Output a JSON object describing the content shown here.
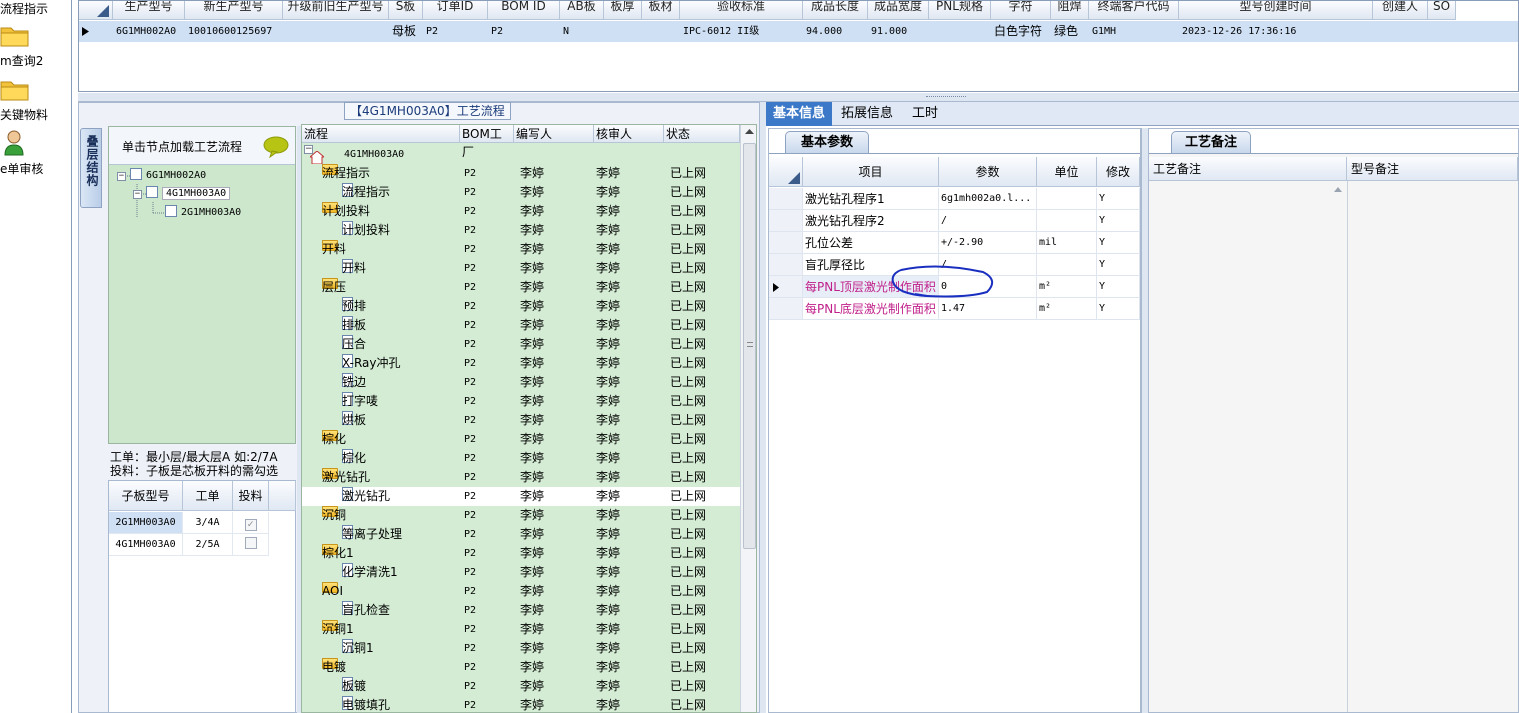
{
  "left_nav": {
    "items": [
      {
        "label": "流程指示",
        "icon": "folder-icon"
      },
      {
        "label": "m查询2",
        "icon": "folder-icon"
      },
      {
        "label": "关键物料",
        "icon": "folder-icon"
      },
      {
        "label": "e单审核",
        "icon": "user-icon"
      }
    ]
  },
  "top_grid": {
    "columns": [
      "生产型号",
      "新生产型号",
      "升级前旧生产型号",
      "S板",
      "订单ID",
      "BOM ID",
      "AB板",
      "板厚",
      "板材",
      "验收标准",
      "成品长度",
      "成品宽度",
      "PNL规格",
      "字符",
      "阻焊",
      "终端客户代码",
      "型号创建时间",
      "创建人",
      "SO"
    ],
    "row": {
      "生产型号": "6G1MH002A0",
      "新生产型号": "10010600125697",
      "S板": "母板",
      "订单ID": "P2",
      "BOM ID": "P2",
      "AB板": "N",
      "验收标准": "IPC-6012 II级",
      "成品长度": "94.000",
      "成品宽度": "91.000",
      "字符": "白色字符",
      "阻焊": "绿色",
      "终端客户代码": "G1MH",
      "型号创建时间": "2023-12-26 17:36:16"
    }
  },
  "process_title": "【4G1MH003A0】工艺流程",
  "vertical_tab": "叠层结构",
  "struct_panel": {
    "hint": "单击节点加载工艺流程",
    "tree": [
      "6G1MH002A0",
      "4G1MH003A0",
      "2G1MH003A0"
    ]
  },
  "struct_info": {
    "line1": "工单：最小层/最大层A 如:2/7A",
    "line2": "投料：子板是芯板开料的需勾选"
  },
  "sub_grid": {
    "headers": [
      "子板型号",
      "工单",
      "投料"
    ],
    "rows": [
      {
        "model": "2G1MH003A0",
        "order": "3/4A",
        "feed": true
      },
      {
        "model": "4G1MH003A0",
        "order": "2/5A",
        "feed": false
      }
    ]
  },
  "process_tree": {
    "headers": [
      "流程",
      "BOM工厂",
      "编写人",
      "核审人",
      "状态"
    ],
    "root": "4G1MH003A0",
    "factory": "P2",
    "writer": "李婷",
    "reviewer": "李婷",
    "status": "已上网",
    "rows": [
      {
        "name": "流程指示",
        "level": 1
      },
      {
        "name": "流程指示",
        "level": 2
      },
      {
        "name": "计划投料",
        "level": 1
      },
      {
        "name": "计划投料",
        "level": 2
      },
      {
        "name": "开料",
        "level": 1
      },
      {
        "name": "开料",
        "level": 2
      },
      {
        "name": "层压",
        "level": 1
      },
      {
        "name": "预排",
        "level": 2
      },
      {
        "name": "排板",
        "level": 2
      },
      {
        "name": "压合",
        "level": 2
      },
      {
        "name": "X-Ray冲孔",
        "level": 2
      },
      {
        "name": "铣边",
        "level": 2
      },
      {
        "name": "打字唛",
        "level": 2
      },
      {
        "name": "烘板",
        "level": 2
      },
      {
        "name": "棕化",
        "level": 1
      },
      {
        "name": "棕化",
        "level": 2
      },
      {
        "name": "激光钻孔",
        "level": 1
      },
      {
        "name": "激光钻孔",
        "level": 2
      },
      {
        "name": "沉铜",
        "level": 1
      },
      {
        "name": "等离子处理",
        "level": 2
      },
      {
        "name": "棕化1",
        "level": 1
      },
      {
        "name": "化学清洗1",
        "level": 2
      },
      {
        "name": "AOI",
        "level": 1
      },
      {
        "name": "盲孔检查",
        "level": 2
      },
      {
        "name": "沉铜1",
        "level": 1
      },
      {
        "name": "沉铜1",
        "level": 2
      },
      {
        "name": "电镀",
        "level": 1
      },
      {
        "name": "板镀",
        "level": 2
      },
      {
        "name": "电镀填孔",
        "level": 2
      }
    ]
  },
  "right_tabs": [
    "基本信息",
    "拓展信息",
    "工时"
  ],
  "basic_params": {
    "tab": "基本参数",
    "headers": [
      "项目",
      "参数",
      "单位",
      "修改"
    ],
    "rows": [
      {
        "item": "激光钻孔程序1",
        "param": "6g1mh002a0.l...",
        "unit": "",
        "mod": "Y"
      },
      {
        "item": "激光钻孔程序2",
        "param": "/",
        "unit": "",
        "mod": "Y"
      },
      {
        "item": "孔位公差",
        "param": "+/-2.90",
        "unit": "mil",
        "mod": "Y"
      },
      {
        "item": "盲孔厚径比",
        "param": "/",
        "unit": "",
        "mod": "Y"
      },
      {
        "item": "每PNL顶层激光制作面积",
        "param": "0",
        "unit": "m²",
        "mod": "Y"
      },
      {
        "item": "每PNL底层激光制作面积",
        "param": "1.47",
        "unit": "m²",
        "mod": "Y"
      }
    ]
  },
  "remarks": {
    "tab": "工艺备注",
    "headers": [
      "工艺备注",
      "型号备注"
    ]
  },
  "colors": {
    "tree_green": "#d4ecd4",
    "selected_blue": "#cfe0f5",
    "tab_active": "#3c78c8",
    "pink_text": "#c0208a",
    "annotation_circle": "#1a2fc0"
  }
}
